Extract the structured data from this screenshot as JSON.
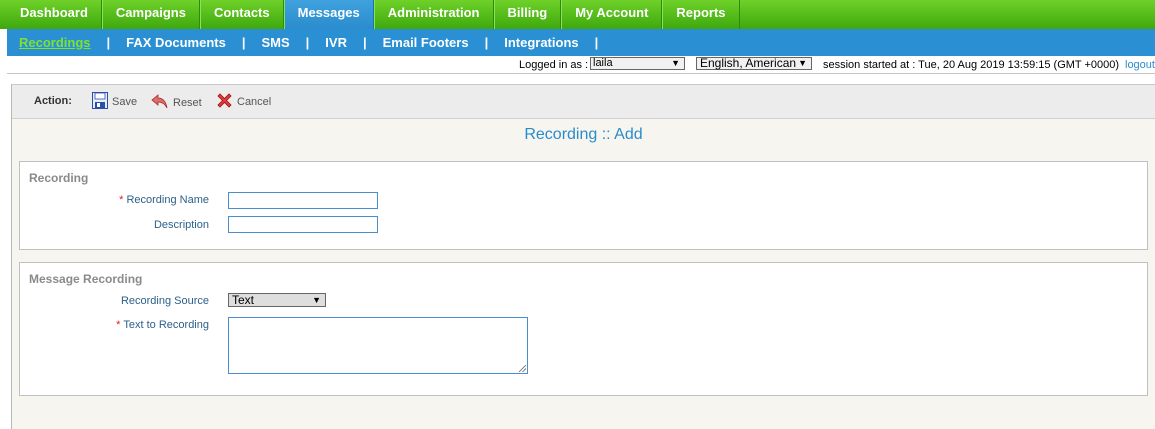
{
  "topnav": {
    "tabs": [
      {
        "label": "Dashboard"
      },
      {
        "label": "Campaigns"
      },
      {
        "label": "Contacts"
      },
      {
        "label": "Messages",
        "active": true
      },
      {
        "label": "Administration"
      },
      {
        "label": "Billing"
      },
      {
        "label": "My Account"
      },
      {
        "label": "Reports"
      }
    ]
  },
  "subnav": {
    "items": [
      {
        "label": "Recordings",
        "active": true
      },
      {
        "label": "FAX Documents"
      },
      {
        "label": "SMS"
      },
      {
        "label": "IVR"
      },
      {
        "label": "Email Footers"
      },
      {
        "label": "Integrations"
      }
    ],
    "separator": "|"
  },
  "loginbar": {
    "logged_in_label": "Logged in as :",
    "user": "laila",
    "language": "English, American",
    "session": "session started at : Tue, 20 Aug 2019 13:59:15 (GMT +0000)",
    "logout": "logout"
  },
  "actions": {
    "label": "Action:",
    "save": "Save",
    "reset": "Reset",
    "cancel": "Cancel"
  },
  "page_title": "Recording :: Add",
  "recording_section": {
    "legend": "Recording",
    "name_label": "Recording Name",
    "name_value": "",
    "description_label": "Description",
    "description_value": ""
  },
  "message_section": {
    "legend": "Message Recording",
    "source_label": "Recording Source",
    "source_value": "Text",
    "text_label": "Text to Recording",
    "text_value": ""
  },
  "colors": {
    "nav_green": "#4bb81a",
    "nav_blue": "#2a90d3",
    "active_sub": "#7fe22c",
    "required": "#e02020"
  }
}
